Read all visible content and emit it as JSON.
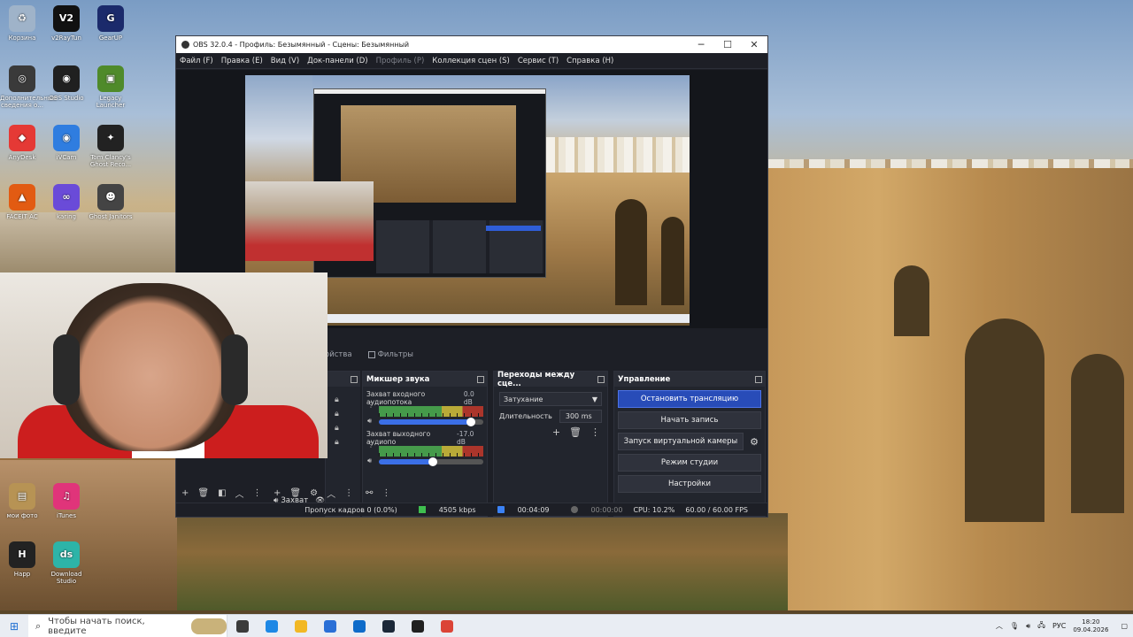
{
  "desktop": {
    "icons": [
      {
        "label": "Корзина",
        "color": "#9fb3c9",
        "glyph": "♻"
      },
      {
        "label": "v2RayTun",
        "color": "#111111",
        "glyph": "V2"
      },
      {
        "label": "GearUP",
        "color": "#1b2a6b",
        "glyph": "G"
      },
      {
        "label": "Дополнительные сведения о...",
        "color": "#3a3a3a",
        "glyph": "◎"
      },
      {
        "label": "OBS Studio",
        "color": "#202020",
        "glyph": "◉"
      },
      {
        "label": "Legacy Launcher",
        "color": "#4f8a2a",
        "glyph": "▣"
      },
      {
        "label": "AnyDesk",
        "color": "#e53935",
        "glyph": "◆"
      },
      {
        "label": "iVCam",
        "color": "#2f7de0",
        "glyph": "◉"
      },
      {
        "label": "Tom Clancy's Ghost Reco...",
        "color": "#222222",
        "glyph": "✦"
      },
      {
        "label": "FACEIT AC",
        "color": "#e25b12",
        "glyph": "▲"
      },
      {
        "label": "karing",
        "color": "#6a4bd8",
        "glyph": "∞"
      },
      {
        "label": "Ghost Janitors",
        "color": "#444444",
        "glyph": "☻"
      },
      {
        "label": "мои фото",
        "color": "#b79354",
        "glyph": "▤"
      },
      {
        "label": "iTunes",
        "color": "#e0347a",
        "glyph": "♫"
      },
      {
        "label": "Happ",
        "color": "#222222",
        "glyph": "H"
      },
      {
        "label": "Download Studio",
        "color": "#2db4a8",
        "glyph": "ds"
      }
    ]
  },
  "window": {
    "title": "OBS 32.0.4 - Профиль: Безымянный - Сцены: Безымянный",
    "minimize": "─",
    "maximize": "☐",
    "close": "✕"
  },
  "menu": [
    "Файл (F)",
    "Правка (E)",
    "Вид (V)",
    "Док-панели (D)",
    "Профиль (P)",
    "Коллекция сцен (S)",
    "Сервис (T)",
    "Справка (H)"
  ],
  "menu_disabled_index": 4,
  "source_tabs": {
    "properties": "ойства",
    "filters": "Фильтры"
  },
  "sources_partial": {
    "label": "Захват"
  },
  "mixer": {
    "title": "Микшер звука",
    "channels": [
      {
        "name": "Захват входного аудиопотока",
        "db": "0.0 dB",
        "level_percent": 88
      },
      {
        "name": "Захват выходного аудиопо",
        "db": "-17.0 dB",
        "level_percent": 52
      }
    ],
    "scale": "-60 -55 -50 -45 -40 -35 -30 -25 -20 -15 -10 -5 0"
  },
  "transitions": {
    "title": "Переходы между сце...",
    "selected": "Затухание",
    "duration_label": "Длительность",
    "duration_value": "300 ms"
  },
  "controls": {
    "title": "Управление",
    "buttons": {
      "stop_stream": "Остановить трансляцию",
      "start_record": "Начать запись",
      "virtual_cam": "Запуск виртуальной камеры",
      "studio_mode": "Режим студии",
      "settings": "Настройки"
    },
    "accent": "#284cb8"
  },
  "status": {
    "dropped": "Пропуск кадров 0 (0.0%)",
    "bitrate": "4505 kbps",
    "stream_time": "00:04:09",
    "record_time": "00:00:00",
    "cpu": "CPU: 10.2%",
    "fps": "60.00 / 60.00 FPS"
  },
  "taskbar": {
    "search_placeholder": "Чтобы начать поиск, введите",
    "apps": [
      {
        "name": "task-view",
        "color": "#3b3b3b"
      },
      {
        "name": "edge",
        "color": "#1e88e5"
      },
      {
        "name": "explorer",
        "color": "#f2b824"
      },
      {
        "name": "store",
        "color": "#2a6fd6"
      },
      {
        "name": "outlook",
        "color": "#0e6bc9"
      },
      {
        "name": "steam",
        "color": "#1b2838"
      },
      {
        "name": "obs",
        "color": "#202020"
      },
      {
        "name": "chrome",
        "color": "#db4437"
      }
    ],
    "lang": "РУС",
    "time": "18:20",
    "date": "09.04.2026"
  }
}
